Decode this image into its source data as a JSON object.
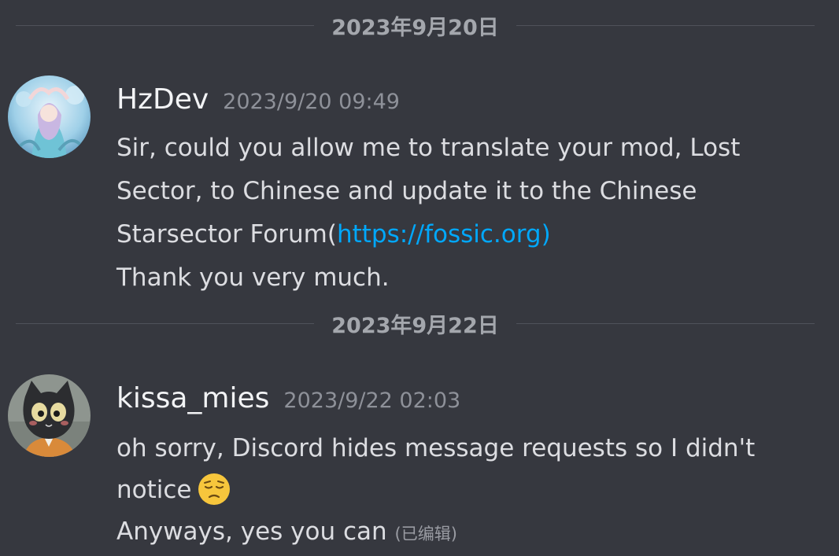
{
  "dividers": [
    {
      "date": "2023年9月20日"
    },
    {
      "date": "2023年9月22日"
    }
  ],
  "messages": [
    {
      "username": "HzDev",
      "timestamp": "2023/9/20 09:49",
      "avatar_icon": "anime-girl-avatar",
      "lines": {
        "l1": "Sir, could you allow me to translate your mod, Lost",
        "l2": "Sector, to Chinese and update it to the Chinese",
        "l3_prefix": "Starsector Forum(",
        "l3_link": "https://fossic.org",
        "l3_suffix": ")",
        "l4": "Thank you very much."
      }
    },
    {
      "username": "kissa_mies",
      "timestamp": "2023/9/22 02:03",
      "avatar_icon": "black-cat-avatar",
      "lines": {
        "l1": "oh sorry, Discord hides message requests so I didn't",
        "l2": "notice",
        "l2_emoji": "pensive-face-emoji",
        "l3": "Anyways, yes you can",
        "edited": "(已编辑)"
      }
    }
  ],
  "colors": {
    "background": "#36383f",
    "link": "#00a8fc",
    "username": "#f2f3f5",
    "timestamp": "#8e9199",
    "divider_line": "#4f525a"
  }
}
